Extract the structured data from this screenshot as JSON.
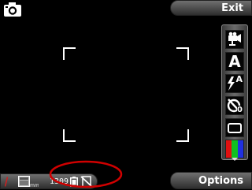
{
  "softkeys": {
    "right_top": "Exit",
    "right_bottom": "Options"
  },
  "status": {
    "photo_count": "1309",
    "memory_label": "mm"
  },
  "toolbar": {
    "items": [
      {
        "icon": "video-mode-icon"
      },
      {
        "icon": "auto-scene-icon"
      },
      {
        "icon": "flash-auto-icon"
      },
      {
        "icon": "self-timer-off-icon"
      },
      {
        "icon": "image-format-icon"
      },
      {
        "icon": "color-tone-icon"
      }
    ],
    "letters": {
      "scene": "A",
      "flash": "A",
      "timer": "0"
    }
  },
  "colors": {
    "annotation": "#d00000",
    "softkey_top": "#707070",
    "softkey_bottom": "#2e2e2e"
  }
}
